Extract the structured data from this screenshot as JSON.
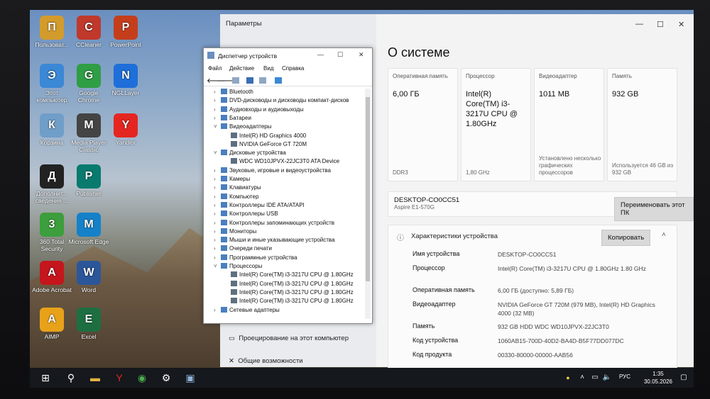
{
  "desktop_icons": [
    {
      "label": "Пользоват...",
      "icon": "user-folder-icon",
      "color": "#d39b2c"
    },
    {
      "label": "CCleaner",
      "icon": "ccleaner-icon",
      "color": "#c0392b"
    },
    {
      "label": "PowerPoint",
      "icon": "powerpoint-icon",
      "color": "#c43e1c"
    },
    {
      "label": "Этот компьютер",
      "icon": "this-pc-icon",
      "color": "#3a88d6"
    },
    {
      "label": "Google Chrome",
      "icon": "chrome-icon",
      "color": "#2f9e44"
    },
    {
      "label": "NGLLayer",
      "icon": "ngl-icon",
      "color": "#1e6fd9"
    },
    {
      "label": "Корзина",
      "icon": "recycle-bin-icon",
      "color": "#6f9ec9"
    },
    {
      "label": "Media Player Classic",
      "icon": "mpc-icon",
      "color": "#444"
    },
    {
      "label": "Yandex",
      "icon": "yandex-icon",
      "color": "#e52620"
    },
    {
      "label": "Дополнит... сведения ...",
      "icon": "info-icon",
      "color": "#222"
    },
    {
      "label": "Publisher",
      "icon": "publisher-icon",
      "color": "#087a6e"
    },
    {
      "label": "360 Total Security",
      "icon": "security-icon",
      "color": "#3c9e3c"
    },
    {
      "label": "Microsoft Edge",
      "icon": "edge-icon",
      "color": "#1581c9"
    },
    {
      "label": "Adobe Acrobat",
      "icon": "acrobat-icon",
      "color": "#c4161c"
    },
    {
      "label": "Word",
      "icon": "word-icon",
      "color": "#2b579a"
    },
    {
      "label": "AIMP",
      "icon": "aimp-icon",
      "color": "#e8a21a"
    },
    {
      "label": "Excel",
      "icon": "excel-icon",
      "color": "#1d6f42"
    }
  ],
  "settings": {
    "window_title": "Параметры",
    "page_title": "О системе",
    "cards": [
      {
        "label": "Оперативная память",
        "value": "6,00 ГБ",
        "foot": "DDR3"
      },
      {
        "label": "Процессор",
        "value": "Intel(R) Core(TM) i3-3217U CPU @ 1.80GHz",
        "foot": "1,80 GHz"
      },
      {
        "label": "Видеоадаптер",
        "value": "1011 MB",
        "foot": "Установлено несколько графических процессоров"
      },
      {
        "label": "Память",
        "value": "932 GB",
        "foot": "Используется 46 GB из 932 GB"
      }
    ],
    "device_name": "DESKTOP-CO0CC51",
    "device_model": "Aspire E1-570G",
    "rename_button": "Переименовать этот ПК",
    "specs_title": "Характеристики устройства",
    "copy_button": "Копировать",
    "specs": [
      {
        "k": "Имя устройства",
        "v": "DESKTOP-CO0CC51"
      },
      {
        "k": "Процессор",
        "v": "Intel(R) Core(TM) i3-3217U CPU @ 1.80GHz 1.80 GHz"
      },
      {
        "k": "Оперативная память",
        "v": "6,00 ГБ (доступно: 5,89 ГБ)"
      },
      {
        "k": "Видеоадаптер",
        "v": "NVIDIA GeForce GT 720M (979 MB), Intel(R) HD Graphics 4000 (32 MB)"
      },
      {
        "k": "Память",
        "v": "932 GB HDD WDC WD10JPVX-22JC3T0"
      },
      {
        "k": "Код устройства",
        "v": "1060AB15-700D-40D2-BA4D-B5F77DD077DC"
      },
      {
        "k": "Код продукта",
        "v": "00330-80000-00000-AAB56"
      }
    ],
    "side_links": [
      "Проецирование на этот компьютер",
      "Общие возможности"
    ]
  },
  "devmgr": {
    "title": "Диспетчер устройств",
    "menu": [
      "Файл",
      "Действие",
      "Вид",
      "Справка"
    ],
    "tree": [
      {
        "t": "Bluetooth",
        "lvl": 0,
        "chev": "›"
      },
      {
        "t": "DVD-дисководы и дисководы компакт-дисков",
        "lvl": 0,
        "chev": "›"
      },
      {
        "t": "Аудиовходы и аудиовыходы",
        "lvl": 0,
        "chev": "›"
      },
      {
        "t": "Батареи",
        "lvl": 0,
        "chev": "›"
      },
      {
        "t": "Видеоадаптеры",
        "lvl": 0,
        "chev": "˅"
      },
      {
        "t": "Intel(R) HD Graphics 4000",
        "lvl": 1,
        "chev": ""
      },
      {
        "t": "NVIDIA GeForce GT 720M",
        "lvl": 1,
        "chev": ""
      },
      {
        "t": "Дисковые устройства",
        "lvl": 0,
        "chev": "˅"
      },
      {
        "t": "WDC WD10JPVX-22JC3T0 ATA Device",
        "lvl": 1,
        "chev": ""
      },
      {
        "t": "Звуковые, игровые и видеоустройства",
        "lvl": 0,
        "chev": "›"
      },
      {
        "t": "Камеры",
        "lvl": 0,
        "chev": "›"
      },
      {
        "t": "Клавиатуры",
        "lvl": 0,
        "chev": "›"
      },
      {
        "t": "Компьютер",
        "lvl": 0,
        "chev": "›"
      },
      {
        "t": "Контроллеры IDE ATA/ATAPI",
        "lvl": 0,
        "chev": "›"
      },
      {
        "t": "Контроллеры USB",
        "lvl": 0,
        "chev": "›"
      },
      {
        "t": "Контроллеры запоминающих устройств",
        "lvl": 0,
        "chev": "›"
      },
      {
        "t": "Мониторы",
        "lvl": 0,
        "chev": "›"
      },
      {
        "t": "Мыши и иные указывающие устройства",
        "lvl": 0,
        "chev": "›"
      },
      {
        "t": "Очереди печати",
        "lvl": 0,
        "chev": "›"
      },
      {
        "t": "Программные устройства",
        "lvl": 0,
        "chev": "›"
      },
      {
        "t": "Процессоры",
        "lvl": 0,
        "chev": "˅"
      },
      {
        "t": "Intel(R) Core(TM) i3-3217U CPU @ 1.80GHz",
        "lvl": 1,
        "chev": ""
      },
      {
        "t": "Intel(R) Core(TM) i3-3217U CPU @ 1.80GHz",
        "lvl": 1,
        "chev": ""
      },
      {
        "t": "Intel(R) Core(TM) i3-3217U CPU @ 1.80GHz",
        "lvl": 1,
        "chev": ""
      },
      {
        "t": "Intel(R) Core(TM) i3-3217U CPU @ 1.80GHz",
        "lvl": 1,
        "chev": ""
      },
      {
        "t": "Сетевые адаптеры",
        "lvl": 0,
        "chev": "›"
      }
    ]
  },
  "taskbar": {
    "lang": "РУС",
    "time": "1:35",
    "date": "30.05.2026"
  }
}
